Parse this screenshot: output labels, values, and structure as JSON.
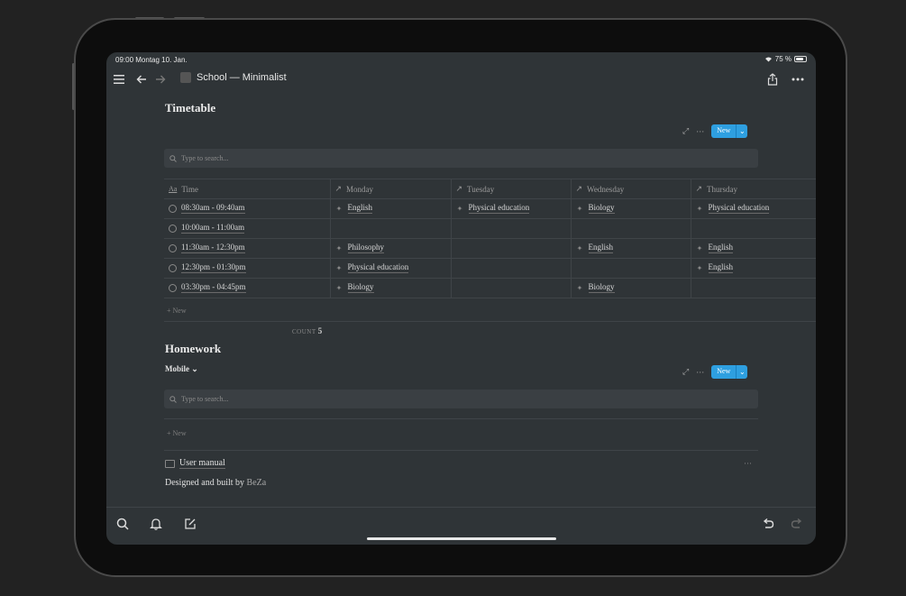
{
  "status": {
    "time": "09:00",
    "date": "Montag 10. Jan.",
    "battery": "75 %",
    "battery_level": 0.75
  },
  "topbar": {
    "title": "School — Minimalist",
    "menu_icon": "menu-icon",
    "back_icon": "back-arrow-icon",
    "forward_icon": "forward-arrow-icon",
    "share_icon": "share-icon",
    "more_icon": "more-icon"
  },
  "timetable": {
    "heading": "Timetable",
    "new_label": "New",
    "search_placeholder": "Type to search...",
    "columns": [
      "Time",
      "Monday",
      "Tuesday",
      "Wednesday",
      "Thursday"
    ],
    "time_icon_text": "Aa",
    "rows": [
      {
        "time": "08:30am - 09:40am",
        "monday": "English",
        "tuesday": "Physical education",
        "wednesday": "Biology",
        "thursday": "Physical education"
      },
      {
        "time": "10:00am - 11:00am",
        "monday": "",
        "tuesday": "",
        "wednesday": "",
        "thursday": ""
      },
      {
        "time": "11:30am - 12:30pm",
        "monday": "Philosophy",
        "tuesday": "",
        "wednesday": "English",
        "thursday": "English"
      },
      {
        "time": "12:30pm - 01:30pm",
        "monday": "Physical education",
        "tuesday": "",
        "wednesday": "",
        "thursday": "English"
      },
      {
        "time": "03:30pm - 04:45pm",
        "monday": "Biology",
        "tuesday": "",
        "wednesday": "Biology",
        "thursday": ""
      }
    ],
    "add_row": "New",
    "count_label": "COUNT",
    "count_value": "5"
  },
  "homework": {
    "heading": "Homework",
    "view_label": "Mobile",
    "new_label": "New",
    "search_placeholder": "Type to search...",
    "add_row": "New"
  },
  "footer": {
    "manual": "User manual",
    "credit_prefix": "Designed and built by",
    "credit_author": "BeZa"
  },
  "colors": {
    "background": "#2f3437",
    "accent": "#2e9fe0",
    "text": "#d4d4d4"
  }
}
